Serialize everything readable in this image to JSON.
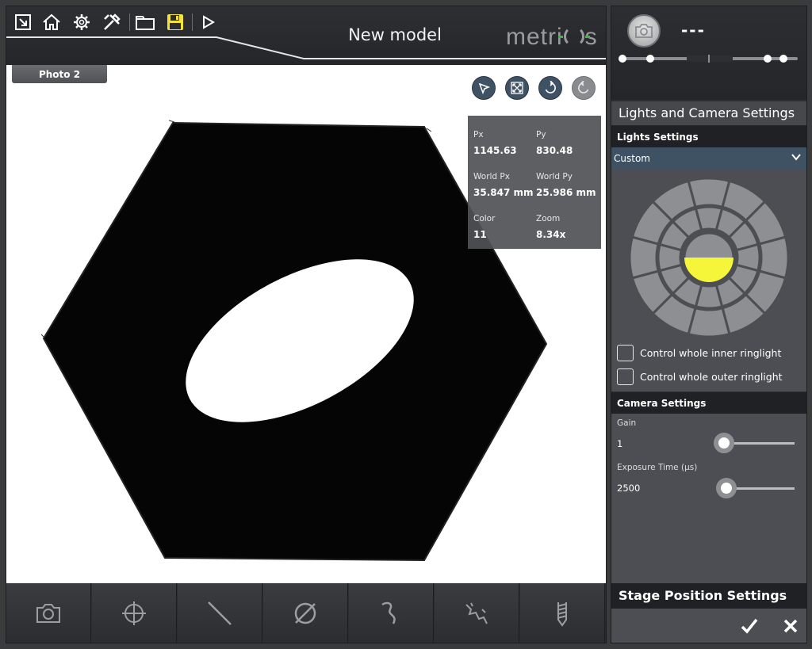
{
  "toolbar": {
    "icons": [
      "exit-window-icon",
      "home-icon",
      "settings-gear-icon",
      "tools-icon",
      "folder-icon",
      "save-icon",
      "play-icon"
    ],
    "save_color": "#f2e23a"
  },
  "window": {
    "title": "New model",
    "brand": "metrios"
  },
  "viewport": {
    "tab_label": "Photo 2",
    "tools": [
      "pointer-icon",
      "fit-view-icon",
      "undo-icon",
      "redo-icon"
    ],
    "info": {
      "px_label": "Px",
      "px_value": "1145.63",
      "py_label": "Py",
      "py_value": "830.48",
      "wpx_label": "World Px",
      "wpx_value": "35.847 mm",
      "wpy_label": "World Py",
      "wpy_value": "25.986 mm",
      "color_label": "Color",
      "color_value": "11",
      "zoom_label": "Zoom",
      "zoom_value": "8.34x"
    }
  },
  "bottom_tools": [
    "camera-icon",
    "crosshair-icon",
    "line-icon",
    "diameter-icon",
    "curve-icon",
    "edge-path-icon",
    "thread-icon"
  ],
  "camera_panel": {
    "name": "---"
  },
  "settings": {
    "title": "Lights and Camera Settings",
    "lights_header": "Lights Settings",
    "lights_mode": "Custom",
    "inner_ring_label": "Control whole inner ringlight",
    "outer_ring_label": "Control whole outer ringlight",
    "active_light_color": "#f5f53a",
    "camera_header": "Camera Settings",
    "gain_label": "Gain",
    "gain_value": "1",
    "exposure_label": "Exposure Time (µs)",
    "exposure_value": "2500",
    "stage_header": "Stage Position Settings"
  },
  "footer": {
    "confirm_icon": "checkmark-icon",
    "cancel_icon": "close-icon"
  }
}
